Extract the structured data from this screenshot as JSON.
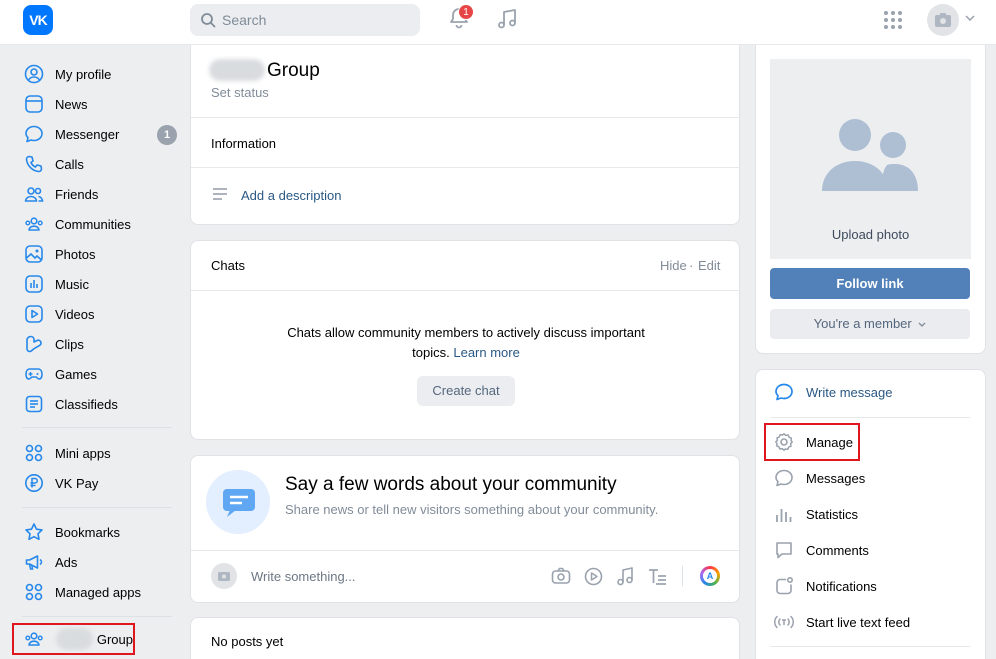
{
  "header": {
    "logo_text": "VK",
    "search_placeholder": "Search",
    "notifications_count": "1",
    "icons": [
      "vk-logo-icon",
      "search-icon",
      "bell-icon",
      "music-icon",
      "apps-grid-icon",
      "camera-icon",
      "chevron-down-icon"
    ]
  },
  "sidebar": {
    "items": [
      {
        "label": "My profile",
        "icon": "user-circle-icon"
      },
      {
        "label": "News",
        "icon": "news-icon"
      },
      {
        "label": "Messenger",
        "icon": "chat-bubble-icon",
        "count": "1"
      },
      {
        "label": "Calls",
        "icon": "phone-icon"
      },
      {
        "label": "Friends",
        "icon": "friends-icon"
      },
      {
        "label": "Communities",
        "icon": "communities-icon"
      },
      {
        "label": "Photos",
        "icon": "photo-icon"
      },
      {
        "label": "Music",
        "icon": "music-icon"
      },
      {
        "label": "Videos",
        "icon": "video-icon"
      },
      {
        "label": "Clips",
        "icon": "clips-icon"
      },
      {
        "label": "Games",
        "icon": "gamepad-icon"
      },
      {
        "label": "Classifieds",
        "icon": "classifieds-icon"
      }
    ],
    "items2": [
      {
        "label": "Mini apps",
        "icon": "mini-apps-icon"
      },
      {
        "label": "VK Pay",
        "icon": "vk-pay-icon"
      }
    ],
    "items3": [
      {
        "label": "Bookmarks",
        "icon": "star-icon"
      },
      {
        "label": "Ads",
        "icon": "megaphone-icon"
      },
      {
        "label": "Managed apps",
        "icon": "managed-apps-icon"
      }
    ],
    "group_label": "Group"
  },
  "community": {
    "name": "Group",
    "set_status": "Set status",
    "information_title": "Information",
    "add_description": "Add a description"
  },
  "chats": {
    "title": "Chats",
    "hide": "Hide",
    "separator": "·",
    "edit": "Edit",
    "body_text": "Chats allow community members to actively discuss important topics.",
    "learn_more": "Learn more",
    "create_button": "Create chat"
  },
  "intro": {
    "title": "Say a few words about your community",
    "subtitle": "Share news or tell new visitors something about your community.",
    "write_placeholder": "Write something..."
  },
  "posts": {
    "empty": "No posts yet"
  },
  "right": {
    "upload_photo": "Upload photo",
    "follow_link": "Follow link",
    "member_label": "You're a member",
    "actions": [
      {
        "label": "Write message",
        "icon": "message-icon"
      },
      {
        "label": "Manage",
        "icon": "gear-icon"
      },
      {
        "label": "Messages",
        "icon": "speech-bubble-icon"
      },
      {
        "label": "Statistics",
        "icon": "bar-chart-icon"
      },
      {
        "label": "Comments",
        "icon": "comment-icon"
      },
      {
        "label": "Notifications",
        "icon": "notification-icon"
      },
      {
        "label": "Start live text feed",
        "icon": "live-feed-icon"
      }
    ]
  },
  "colors": {
    "brand": "#0077ff",
    "follow_button": "#5181b8",
    "highlight_border": "#e0161e",
    "badge": "#e64646"
  }
}
